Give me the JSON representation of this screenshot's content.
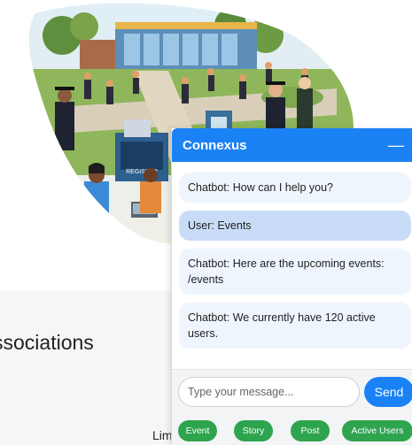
{
  "page": {
    "section_heading": "ssociations",
    "footer_fragment": "Lim"
  },
  "chat": {
    "title": "Connexus",
    "minimize_symbol": "—",
    "messages": [
      {
        "sender": "bot",
        "text": "Chatbot: How can I help you?"
      },
      {
        "sender": "user",
        "text": "User: Events"
      },
      {
        "sender": "bot",
        "text": "Chatbot: Here are the upcoming events: /events"
      },
      {
        "sender": "bot",
        "text": "Chatbot: We currently have 120 active users."
      }
    ],
    "input_placeholder": "Type your message...",
    "send_label": "Send",
    "quick_actions": [
      "Event",
      "Story",
      "Post",
      "Active Users"
    ],
    "colors": {
      "header": "#1a82f5",
      "send": "#1a82f5",
      "quick_action": "#2ea44f",
      "bot_bubble": "#eef5fd",
      "user_bubble": "#c8dcf8"
    }
  },
  "hero": {
    "sign_text": "REGISTER"
  }
}
